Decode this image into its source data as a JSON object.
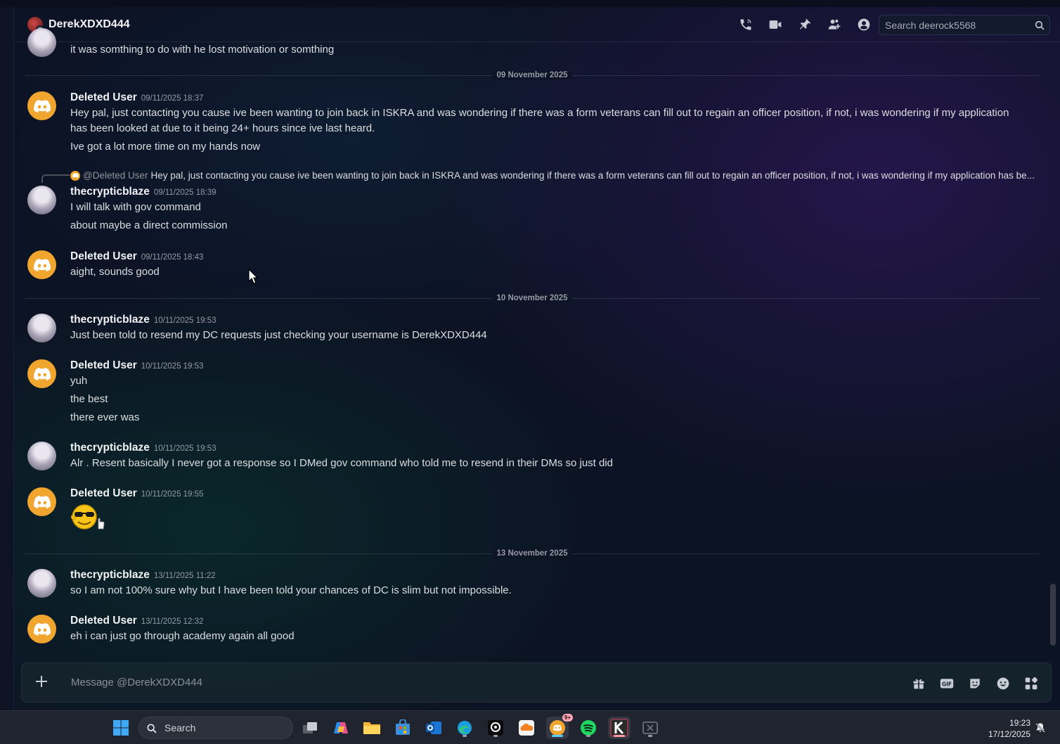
{
  "header": {
    "dm_name": "DerekXDXD444",
    "search_placeholder": "Search deerock5568",
    "icons": [
      "voice-call-icon",
      "video-call-icon",
      "pin-icon",
      "add-friends-icon",
      "user-profile-icon",
      "search-icon"
    ]
  },
  "dividers": [
    "09 November 2025",
    "10 November 2025",
    "13 November 2025"
  ],
  "top_cut_line": "it was somthing to do with he lost motivation or somthing",
  "messages": [
    {
      "author": "Deleted User",
      "timestamp": "09/11/2025 18:37",
      "lines": [
        "Hey pal, just contacting you cause ive been wanting to join back in ISKRA and was wondering if there was a form veterans can fill out to regain an officer position, if not, i was wondering if my application",
        "has been looked at due to it being 24+ hours since ive last heard.",
        "Ive got a lot more time on my hands now"
      ]
    },
    {
      "reply_to_name": "@Deleted User",
      "reply_preview": "Hey pal, just contacting you cause ive been wanting to join back in ISKRA and was wondering if there was a form veterans can fill out to regain an officer position, if not, i was wondering if my application has be...",
      "author": "thecrypticblaze",
      "timestamp": "09/11/2025 18:39",
      "lines": [
        "I will talk with gov command",
        "about maybe a direct commission"
      ]
    },
    {
      "author": "Deleted User",
      "timestamp": "09/11/2025 18:43",
      "lines": [
        "aight, sounds good"
      ]
    },
    {
      "author": "thecrypticblaze",
      "timestamp": "10/11/2025 19:53",
      "lines": [
        "Just been told to resend my DC requests just checking your username is DerekXDXD444"
      ]
    },
    {
      "author": "Deleted User",
      "timestamp": "10/11/2025 19:53",
      "lines": [
        "yuh",
        "the best",
        "there ever was"
      ]
    },
    {
      "author": "thecrypticblaze",
      "timestamp": "10/11/2025 19:53",
      "lines": [
        "Alr . Resent basically I never got a response so I DMed gov command who told me to resend in their DMs so just did"
      ]
    },
    {
      "author": "Deleted User",
      "timestamp": "10/11/2025 19:55",
      "sticker": "sunglasses-thumbs-up-emoji"
    },
    {
      "author": "thecrypticblaze",
      "timestamp": "13/11/2025 11:22",
      "lines": [
        "so I am not 100% sure why but I have been told your chances of DC is slim but not impossible."
      ]
    },
    {
      "author": "Deleted User",
      "timestamp": "13/11/2025 12:32",
      "lines": [
        "eh i can just go through academy again all good"
      ]
    }
  ],
  "composer": {
    "placeholder": "Message @DerekXDXD444",
    "icons": [
      "gift-icon",
      "gif-icon",
      "sticker-icon",
      "emoji-icon",
      "apps-icon"
    ]
  },
  "taskbar": {
    "search_label": "Search",
    "time": "19:23",
    "date": "17/12/2025",
    "discord_badge": "9+"
  },
  "colors": {
    "discord_avatar": "#f0a52e",
    "username": "#f2f3f5",
    "timestamp": "#949ba4",
    "text": "#dbdee1"
  }
}
